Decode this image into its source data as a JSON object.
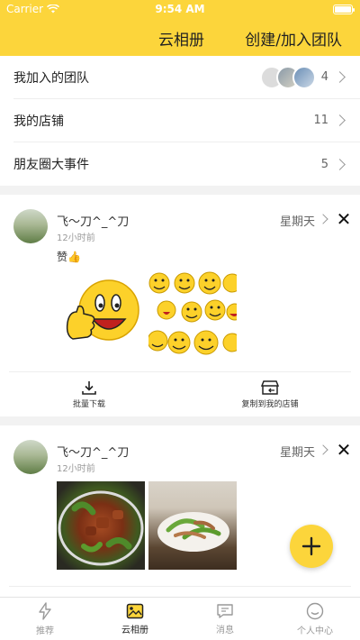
{
  "status": {
    "carrier": "Carrier",
    "time": "9:54 AM"
  },
  "nav": {
    "title": "云相册",
    "action": "创建/加入团队"
  },
  "toplist": [
    {
      "label": "我加入的团队",
      "count": "4"
    },
    {
      "label": "我的店铺",
      "count": "11"
    },
    {
      "label": "朋友圈大事件",
      "count": "5"
    }
  ],
  "posts": [
    {
      "name": "飞～刀^_^刀",
      "ago": "12小时前",
      "day": "星期天",
      "text": "赞👍"
    },
    {
      "name": "飞～刀^_^刀",
      "ago": "12小时前",
      "day": "星期天"
    }
  ],
  "actions": {
    "download": "批量下载",
    "copy": "复制到我的店铺"
  },
  "tabs": [
    {
      "label": "推荐",
      "icon": "lightning-icon"
    },
    {
      "label": "云相册",
      "icon": "photo-icon"
    },
    {
      "label": "消息",
      "icon": "message-icon"
    },
    {
      "label": "个人中心",
      "icon": "smile-icon"
    }
  ],
  "colors": {
    "accent": "#fcd53b",
    "background": "#f2f2f2"
  }
}
